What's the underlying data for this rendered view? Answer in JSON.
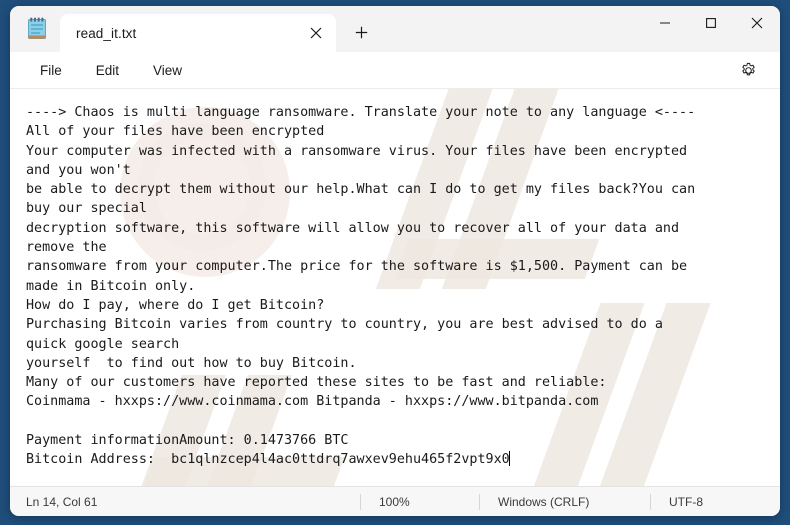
{
  "window": {
    "background_color": "#1f4e7b",
    "app_icon": "notepad-icon",
    "minimize_label": "Minimize",
    "maximize_label": "Maximize",
    "close_label": "Close"
  },
  "tabs": [
    {
      "title": "read_it.txt",
      "close_label": "Close tab",
      "active": true
    }
  ],
  "newtab": {
    "label": "+",
    "tooltip": "New tab"
  },
  "menubar": {
    "items": [
      {
        "label": "File"
      },
      {
        "label": "Edit"
      },
      {
        "label": "View"
      }
    ],
    "settings_icon": "gear-icon"
  },
  "editor": {
    "content": "----> Chaos is multi language ransomware. Translate your note to any language <----\nAll of your files have been encrypted\nYour computer was infected with a ransomware virus. Your files have been encrypted\nand you won't\nbe able to decrypt them without our help.What can I do to get my files back?You can\nbuy our special\ndecryption software, this software will allow you to recover all of your data and\nremove the\nransomware from your computer.The price for the software is $1,500. Payment can be\nmade in Bitcoin only.\nHow do I pay, where do I get Bitcoin?\nPurchasing Bitcoin varies from country to country, you are best advised to do a\nquick google search\nyourself  to find out how to buy Bitcoin.\nMany of our customers have reported these sites to be fast and reliable:\nCoinmama - hxxps://www.coinmama.com Bitpanda - hxxps://www.bitpanda.com\n\nPayment informationAmount: 0.1473766 BTC\nBitcoin Address:  bc1qlnzcep4l4ac0ttdrq7awxev9ehu465f2vpt9x0",
    "amount_btc": "0.1473766 BTC",
    "bitcoin_address": "bc1qlnzcep4l4ac0ttdrq7awxev9ehu465f2vpt9x0",
    "ransom_price": "$1,500",
    "text_color": "#1a1a1a"
  },
  "statusbar": {
    "line_col": "Ln 14, Col 61",
    "zoom": "100%",
    "line_ending": "Windows (CRLF)",
    "encoding": "UTF-8"
  }
}
